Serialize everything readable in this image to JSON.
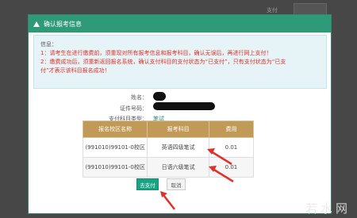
{
  "background": {
    "col1": "支付",
    "col2": "支付"
  },
  "modal": {
    "title": "确认报考信息",
    "notice": {
      "title": "信息：",
      "line1": "1：请考生在进行缴费前，须重现对所有报考信息和报考科目，确认无误后，再进行网上支付！",
      "line2": "2：缴费成功后，须重新返回报名系统，确认支付科目的支付状态为“已支付”，只有支付状态为“已支",
      "line3": "付”才表示该科目报名成功！"
    },
    "fields": {
      "name_label": "姓名：",
      "id_label": "证件号码：",
      "paytype_label": "支付科目类型：",
      "paytype_value": "笔试"
    },
    "table": {
      "headers": [
        "报名校区名称",
        "报考科目",
        "费用"
      ],
      "rows": [
        [
          "(991010)99101-0校区",
          "英语四级笔试",
          "0.01"
        ],
        [
          "(991010)99101-0校区",
          "日语六级笔试",
          "0.01"
        ]
      ]
    },
    "buttons": {
      "pay": "去支付",
      "cancel": "取消"
    }
  },
  "watermark": "若水网",
  "colors": {
    "header": "#2e9a78",
    "table_header": "#c09a56",
    "warning_text": "#e0302a",
    "annotation_arrow": "#e0302a"
  }
}
